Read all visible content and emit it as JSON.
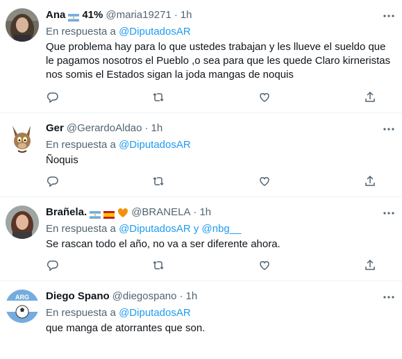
{
  "tweets": [
    {
      "name": "Ana",
      "flags": [
        "argentina"
      ],
      "extra": "41%",
      "handle": "@maria19271",
      "time": "1h",
      "reply_prefix": "En respuesta a",
      "mentions": "@DiputadosAR",
      "lines": [
        "Que problema hay para lo  que ustedes trabajan y les  llueve el sueldo que",
        "le pagamos  nosotros el Pueblo ,o sea para que les quede Claro kirneristas",
        "nos somis el Estados  sigan la joda mangas de noquis"
      ],
      "avatar": "woman-long-hair-photo"
    },
    {
      "name": "Ger",
      "flags": [],
      "extra": "",
      "handle": "@GerardoAldao",
      "time": "1h",
      "reply_prefix": "En respuesta a",
      "mentions": "@DiputadosAR",
      "lines": [
        "Ñoquis"
      ],
      "avatar": "cartoon-coyote"
    },
    {
      "name": "Brañela.",
      "flags": [
        "argentina",
        "spain",
        "orange-heart"
      ],
      "extra": "",
      "handle": "@BRANELA",
      "time": "1h",
      "reply_prefix": "En respuesta a",
      "mentions": "@DiputadosAR y @nbg__",
      "lines": [
        "Se rascan todo el año,  no va a ser diferente ahora."
      ],
      "avatar": "woman-photo"
    },
    {
      "name": "Diego Spano",
      "flags": [],
      "extra": "",
      "handle": "@diegospano",
      "time": "1h",
      "reply_prefix": "En respuesta a",
      "mentions": "@DiputadosAR",
      "lines": [
        "que manga de atorrantes que son."
      ],
      "avatar": "arg-football-badge"
    }
  ],
  "avatar_badge_text": "ARG",
  "colors": {
    "link": "#1d9bf0",
    "secondary": "#536471",
    "text": "#0f1419",
    "divider": "#eff3f4"
  }
}
